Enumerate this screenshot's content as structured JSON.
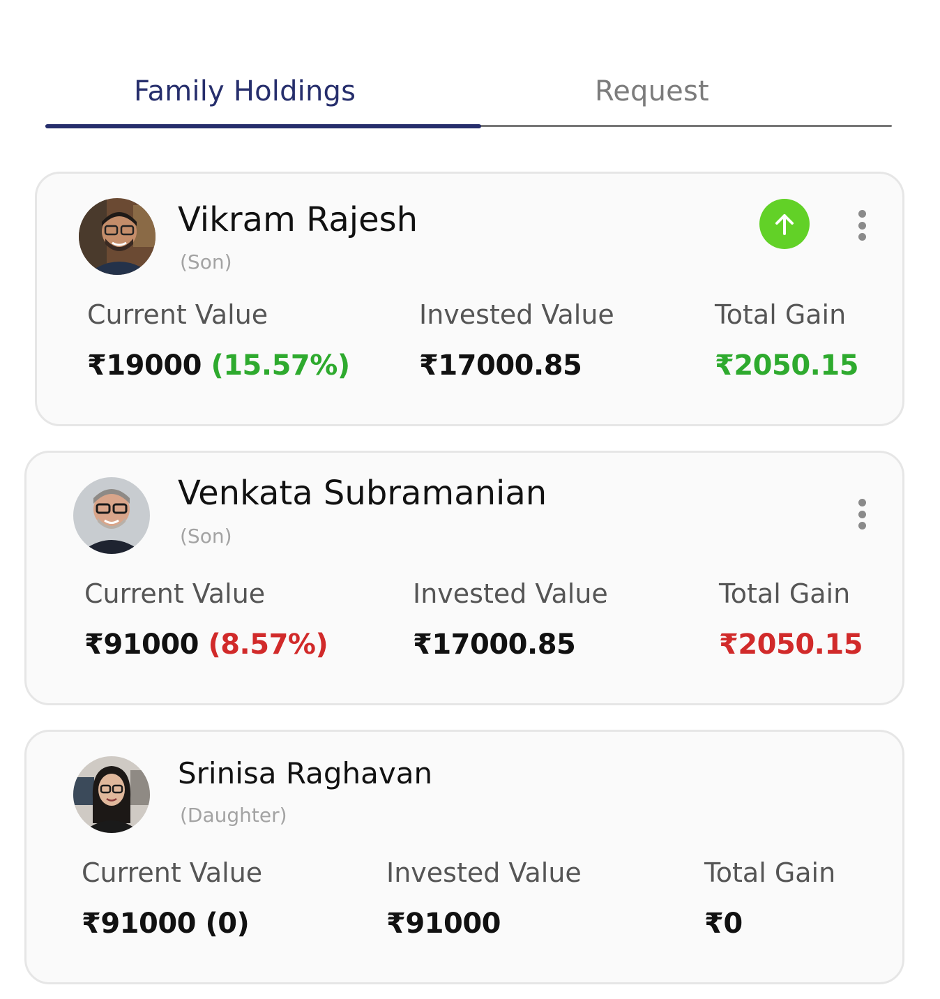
{
  "tabs": {
    "active_label": "Family Holdings",
    "inactive_label": "Request"
  },
  "labels": {
    "current_value": "Current Value",
    "invested_value": "Invested Value",
    "total_gain": "Total Gain"
  },
  "colors": {
    "accent": "#262e6c",
    "gain_positive": "#2eaa2e",
    "gain_negative": "#d12a2a",
    "up_indicator": "#62d127"
  },
  "members": [
    {
      "name": "Vikram Rajesh",
      "relation": "(Son)",
      "current_value": "₹19000",
      "current_change": "(15.57%)",
      "invested_value": "₹17000.85",
      "total_gain": "₹2050.15",
      "trend": "up",
      "icons": [
        "avatar",
        "arrow-up-icon",
        "more-vertical-icon"
      ]
    },
    {
      "name": "Venkata Subramanian",
      "relation": "(Son)",
      "current_value": "₹91000",
      "current_change": "(8.57%)",
      "invested_value": "₹17000.85",
      "total_gain": "₹2050.15",
      "trend": "down",
      "icons": [
        "avatar",
        "more-vertical-icon"
      ]
    },
    {
      "name": "Srinisa Raghavan",
      "relation": "(Daughter)",
      "current_value": "₹91000",
      "current_change": "(0)",
      "invested_value": "₹91000",
      "total_gain": "₹0",
      "trend": "neutral",
      "icons": [
        "avatar"
      ]
    }
  ]
}
